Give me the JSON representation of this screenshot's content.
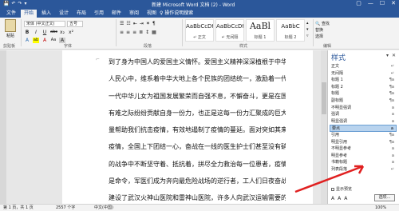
{
  "titlebar": {
    "title": "新建 Microsoft Word 文档 (2) - Word",
    "qat": [
      "💾",
      "↶",
      "↷",
      "▾"
    ],
    "win": [
      "▢",
      "—",
      "☐",
      "✕"
    ]
  },
  "tabs": [
    {
      "label": "文件"
    },
    {
      "label": "开始"
    },
    {
      "label": "插入"
    },
    {
      "label": "设计"
    },
    {
      "label": "布局"
    },
    {
      "label": "引用"
    },
    {
      "label": "邮件"
    },
    {
      "label": "审阅"
    },
    {
      "label": "视图"
    }
  ],
  "tellme": "♀ 操作说明搜索",
  "ribbon": {
    "paste_label": "粘贴",
    "font_name": "宋体 (中文正文)",
    "font_size": "五号",
    "fmt_row1": [
      "B",
      "I",
      "U",
      "abc",
      "x₂",
      "x²"
    ],
    "fmt_row2": [
      "A",
      "ab",
      "A",
      "Aa",
      "A"
    ],
    "para_row1": [
      "☰",
      "☷",
      "⇤",
      "⇥",
      "✶",
      "¶"
    ],
    "para_row2": [
      "≡",
      "≡",
      "≡",
      "≣",
      "↕",
      "▦"
    ],
    "groups": {
      "clipboard": "剪贴板",
      "font": "字体",
      "paragraph": "段落",
      "styles": "样式",
      "editing": "编辑"
    },
    "styles": [
      {
        "preview": "AaBbCcDt",
        "label": "↵ 正文",
        "big": false
      },
      {
        "preview": "AaBbCcDt",
        "label": "↵ 无间隔",
        "big": false
      },
      {
        "preview": "AaBl",
        "label": "标题 1",
        "big": true
      },
      {
        "preview": "AaBbC",
        "label": "标题 2",
        "big": false
      }
    ],
    "gallery_arrows": [
      "▴",
      "▾",
      "▿"
    ],
    "editing_items": [
      "🔍 查找",
      "替换",
      "选择"
    ]
  },
  "document": {
    "lines": [
      "到了身为中国人的爱国主义情怀。爱国主义精神深深植根于中华",
      "人民心中，维系着中华大地上各个民族的团结统一，激励着一代又",
      "一代中华儿女为祖国发展繁荣而自强不息，不懈奋斗，更是在国家",
      "有难之际纷纷贡献自身一份力，也正是这每一份力汇聚成的巨大力",
      "量帮助我们抗击疫情，有效地遏制了疫情的蔓延。面对突如其来的",
      "疫情，全国上下团结一心，奋战在一线的医生护士们甚至没有硝烟",
      "的战争中不断坚守着、抵抗着，拼尽全力救治每一位患者，疫情就",
      "是命令，军医们成为奔向最危险战场的逆行者，工人们日夜奋战，",
      "建设了武汉火神山医院和雷神山医院，许多人向武汉运输需要的食",
      "物、口罩等等，也有人纷纷捐款支援武汉，为武汉加油……疫情就"
    ]
  },
  "pane": {
    "title": "样式",
    "controls": [
      "▾",
      "✕"
    ],
    "items": [
      {
        "label": "正文",
        "mark": "↵"
      },
      {
        "label": "无间隔",
        "mark": "↵"
      },
      {
        "label": "标题 1",
        "mark": "¶a"
      },
      {
        "label": "标题 2",
        "mark": "¶a"
      },
      {
        "label": "标题",
        "mark": "¶a"
      },
      {
        "label": "副标题",
        "mark": "¶a"
      },
      {
        "label": "不明显强调",
        "mark": "a"
      },
      {
        "label": "强调",
        "mark": "a"
      },
      {
        "label": "明显强调",
        "mark": "a"
      },
      {
        "label": "要点",
        "mark": "a"
      },
      {
        "label": "引用",
        "mark": "¶a"
      },
      {
        "label": "明显引用",
        "mark": "¶a"
      },
      {
        "label": "不明显参考",
        "mark": "a"
      },
      {
        "label": "明显参考",
        "mark": "a"
      },
      {
        "label": "书籍标题",
        "mark": "a"
      },
      {
        "label": "列表段落",
        "mark": "↵"
      }
    ],
    "selected_index": 9,
    "checks": [
      "显示预览",
      "禁用链接样式"
    ],
    "buttons": [
      "A",
      "A",
      "A"
    ],
    "options_label": "选项..."
  },
  "statusbar": {
    "page": "第 1 页，共 1 页",
    "words": "2557 个字",
    "lang": "中文(中国)",
    "zoom": "100%"
  }
}
